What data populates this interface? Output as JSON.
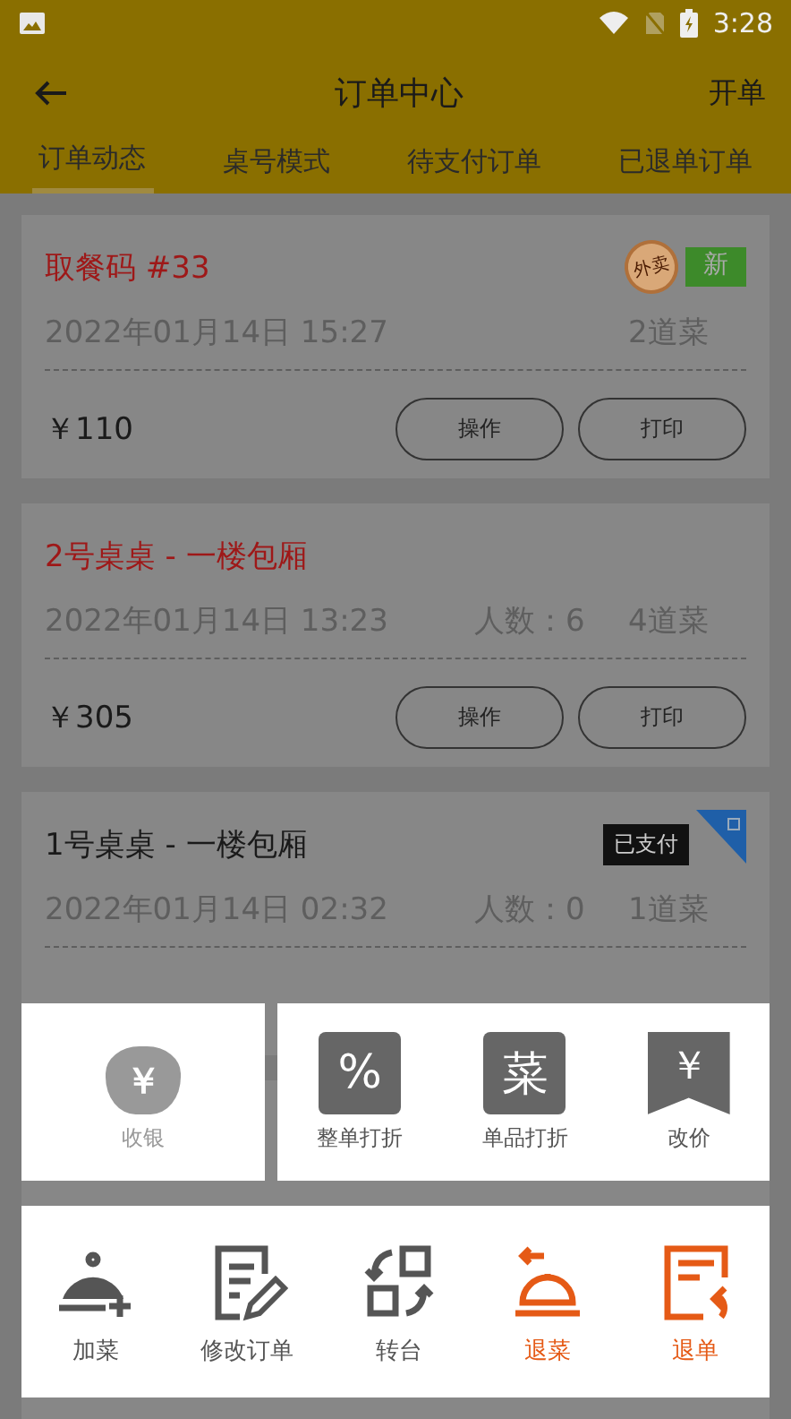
{
  "status_bar": {
    "time": "3:28"
  },
  "toolbar": {
    "title": "订单中心",
    "action": "开单"
  },
  "tabs": [
    {
      "label": "订单动态",
      "selected": true
    },
    {
      "label": "桌号模式",
      "selected": false
    },
    {
      "label": "待支付订单",
      "selected": false
    },
    {
      "label": "已退单订单",
      "selected": false
    }
  ],
  "orders": [
    {
      "title": "取餐码 #33",
      "color": "#9e1818",
      "time": "2022年01月14日 15:27",
      "dishes": "2道菜",
      "price": "￥110",
      "buttons": [
        "操作",
        "打印"
      ],
      "badges": [
        {
          "kind": "stamp",
          "text": "外卖"
        },
        {
          "kind": "flag",
          "text": "新"
        }
      ]
    },
    {
      "title": "2号桌桌 - 一楼包厢",
      "color": "#9e1818",
      "time": "2022年01月14日 13:23",
      "people": "人数：6",
      "dishes": "4道菜",
      "price": "￥305",
      "buttons": [
        "操作",
        "打印"
      ]
    },
    {
      "title": "1号桌桌 - 一楼包厢",
      "color": "#1a1a1a",
      "time": "2022年01月14日 02:32",
      "people": "人数：0",
      "dishes": "1道菜",
      "badges": [
        {
          "kind": "tag",
          "text": "已支付"
        },
        {
          "kind": "corner"
        }
      ]
    }
  ],
  "top_actions": [
    {
      "label": "收银",
      "kind": "bag",
      "glyph": "￥",
      "disabled": true
    },
    {
      "label": "整单打折",
      "kind": "square",
      "glyph": "%",
      "disabled": false
    },
    {
      "label": "单品打折",
      "kind": "square",
      "glyph": "菜",
      "disabled": false
    },
    {
      "label": "改价",
      "kind": "ribbon",
      "glyph": "￥",
      "disabled": false
    }
  ],
  "bottom_actions": [
    {
      "label": "加菜",
      "kind": "cloche",
      "danger": false
    },
    {
      "label": "修改订单",
      "kind": "edit",
      "danger": false
    },
    {
      "label": "转台",
      "kind": "swap",
      "danger": false
    },
    {
      "label": "退菜",
      "kind": "bellback",
      "danger": true
    },
    {
      "label": "退单",
      "kind": "docback",
      "danger": true
    }
  ]
}
